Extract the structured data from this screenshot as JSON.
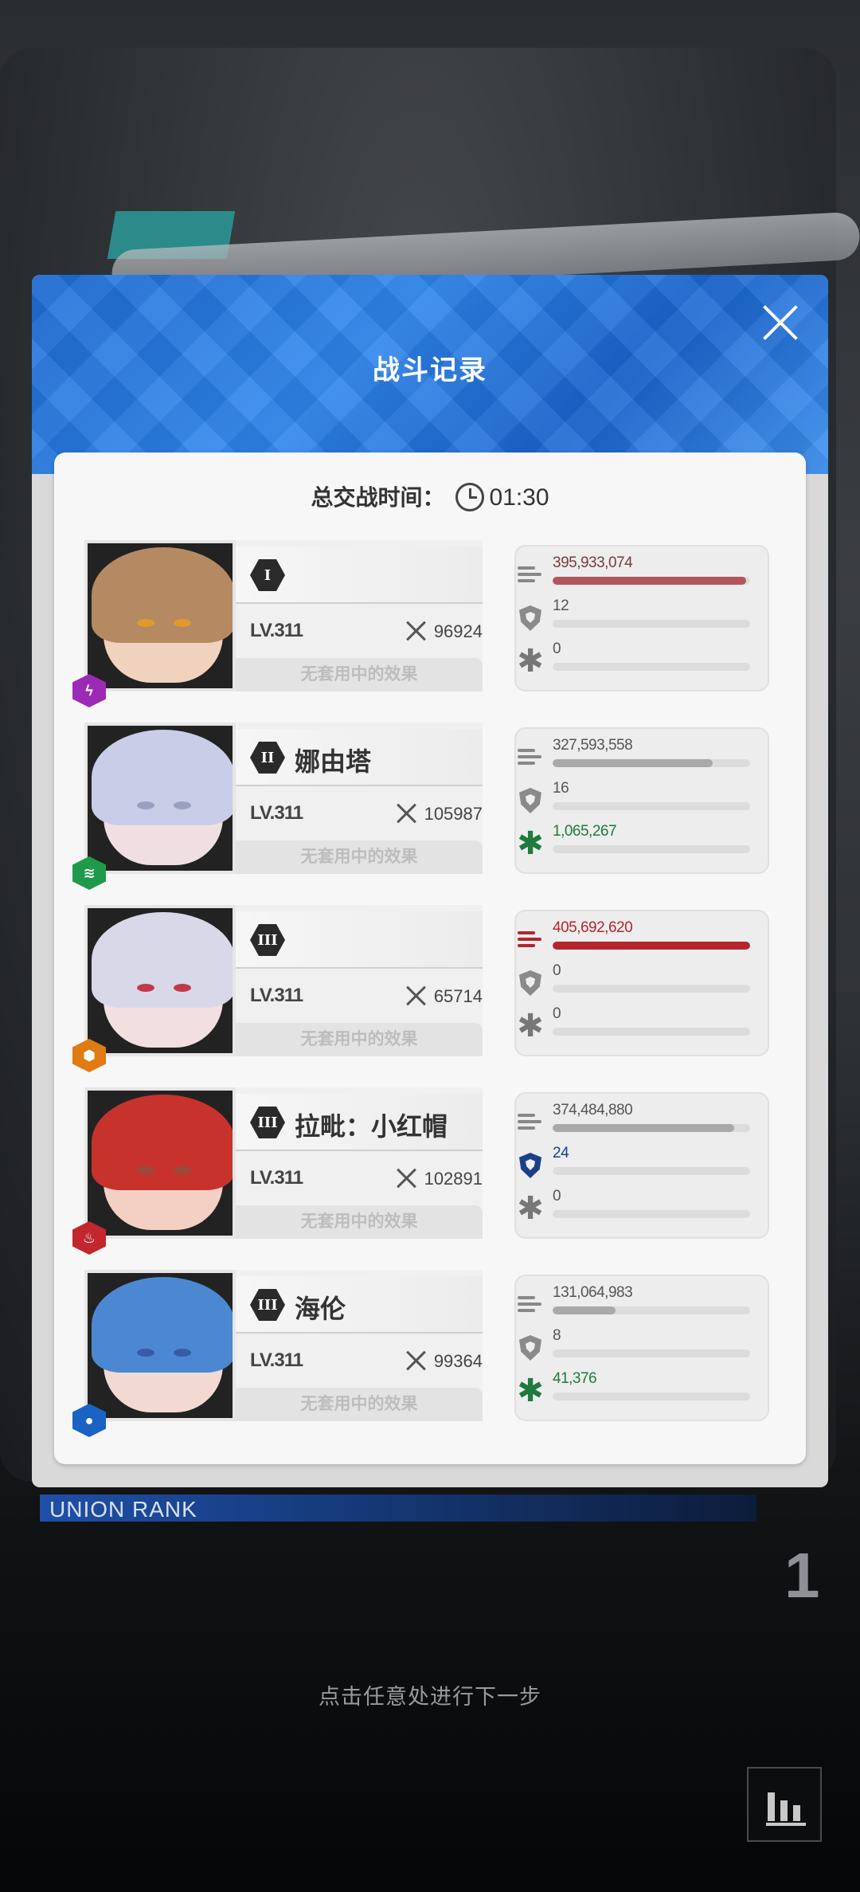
{
  "modal": {
    "title": "战斗记录",
    "timer_label": "总交战时间：",
    "timer_value": "01:30"
  },
  "effect_text": "无套用中的效果",
  "units": [
    {
      "rank": "I",
      "name": "",
      "level": "LV.311",
      "power": "96924",
      "element": "lightning",
      "element_color": "#9b2bb5",
      "portrait": {
        "hair": "#b58a63",
        "face": "#f1d2bf",
        "eye": "#e09a2c"
      },
      "damage": "395,933,074",
      "damage_pct": 0.98,
      "damage_color": "#b0565a",
      "shield": "12",
      "shield_pct": 0.0,
      "heal": "0",
      "heal_pct": 0.0
    },
    {
      "rank": "II",
      "name": "娜由塔",
      "level": "LV.311",
      "power": "105987",
      "element": "wind",
      "element_color": "#1f9a4a",
      "portrait": {
        "hair": "#c9cde8",
        "face": "#f0dfe2",
        "eye": "#9aa0c0"
      },
      "damage": "327,593,558",
      "damage_pct": 0.81,
      "damage_color": "#a9a9a9",
      "shield": "16",
      "shield_pct": 0.0,
      "heal": "1,065,267",
      "heal_pct": 0.0,
      "heal_color": "#1e7a3e"
    },
    {
      "rank": "III",
      "name": "",
      "level": "LV.311",
      "power": "65714",
      "element": "iron",
      "element_color": "#e07a12",
      "portrait": {
        "hair": "#d8d8e8",
        "face": "#f2dfe0",
        "eye": "#c23a4a"
      },
      "damage": "405,692,620",
      "damage_pct": 1.0,
      "damage_color": "#b3262c",
      "shield": "0",
      "shield_pct": 0.0,
      "heal": "0",
      "heal_pct": 0.0
    },
    {
      "rank": "III",
      "name": "拉毗：小红帽",
      "level": "LV.311",
      "power": "102891",
      "element": "fire",
      "element_color": "#c1272d",
      "portrait": {
        "hair": "#c8322d",
        "face": "#f3d0c3",
        "eye": "#9a4a3a"
      },
      "damage": "374,484,880",
      "damage_pct": 0.92,
      "damage_color": "#a9a9a9",
      "shield": "24",
      "shield_pct": 0.0,
      "shield_color": "#1d3f8a",
      "heal": "0",
      "heal_pct": 0.0
    },
    {
      "rank": "III",
      "name": "海伦",
      "level": "LV.311",
      "power": "99364",
      "element": "water",
      "element_color": "#1a63c4",
      "portrait": {
        "hair": "#4b88d1",
        "face": "#f2dad3",
        "eye": "#3a5aa8"
      },
      "damage": "131,064,983",
      "damage_pct": 0.32,
      "damage_color": "#a9a9a9",
      "shield": "8",
      "shield_pct": 0.0,
      "heal": "41,376",
      "heal_pct": 0.0,
      "heal_color": "#1e7a3e"
    }
  ],
  "union_rank": {
    "label": "UNION RANK",
    "value": "1"
  },
  "hint": "点击任意处进行下一步",
  "icons": {
    "close": "close-icon",
    "clock": "clock-icon",
    "damage": "damage-icon",
    "shield": "shield-icon",
    "heal": "heal-icon",
    "chart": "bar-chart-icon",
    "power": "crossed-swords-icon"
  }
}
